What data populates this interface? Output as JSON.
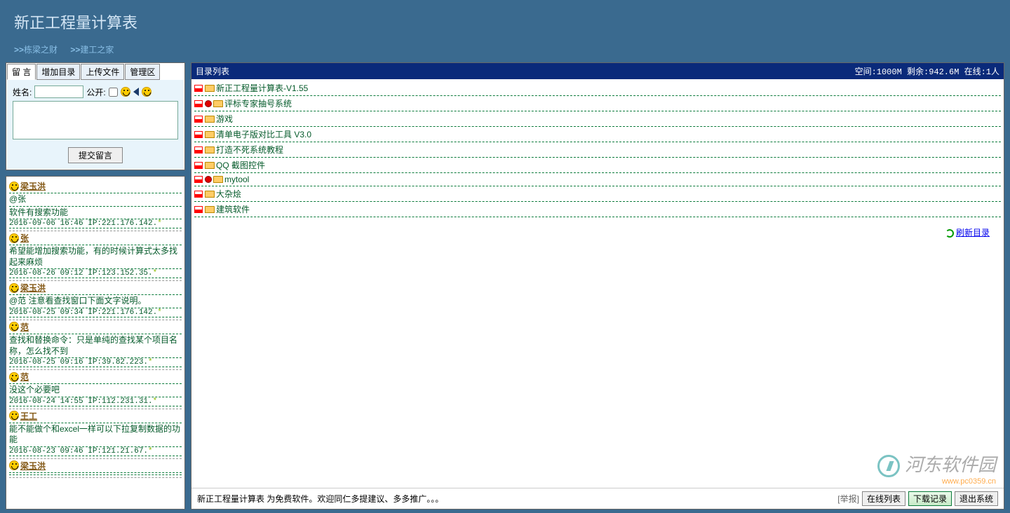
{
  "header": {
    "title": "新正工程量计算表",
    "links": [
      "栋梁之财",
      "建工之家"
    ]
  },
  "tabs": [
    "留 言",
    "增加目录",
    "上传文件",
    "管理区"
  ],
  "form": {
    "name_label": "姓名:",
    "public_label": "公开:",
    "submit": "提交留言"
  },
  "messages": [
    {
      "name": "梁玉洪",
      "body": "@张\n软件有搜索功能",
      "meta": "2016-09-06 16:46 IP:221.176.142.*"
    },
    {
      "name": "张",
      "body": "希望能增加搜索功能，有的时候计算式太多找起来麻烦",
      "meta": "2016-08-26 09:12 IP:123.152.35.*"
    },
    {
      "name": "梁玉洪",
      "body": "@范 注意看查找窗口下面文字说明。",
      "meta": "2016-08-25 09:34 IP:221.176.142.*"
    },
    {
      "name": "范",
      "body": "查找和替换命令：只是单纯的查找某个项目名称，怎么找不到",
      "meta": "2016-08-25 09:16 IP:39.82.223.*"
    },
    {
      "name": "范",
      "body": "没这个必要吧",
      "meta": "2016-08-24 14:55 IP:112.231.31.*"
    },
    {
      "name": "王工",
      "body": "能不能做个和excel一样可以下拉复制数据的功能",
      "meta": "2016-08-23 09:46 IP:121.21.67.*"
    },
    {
      "name": "梁玉洪",
      "body": "",
      "meta": ""
    }
  ],
  "dir_header": {
    "title": "目录列表",
    "stats": "空间:1000M 剩余:942.6M 在线:1人"
  },
  "dirs": [
    {
      "locked": false,
      "name": "新正工程量计算表-V1.55"
    },
    {
      "locked": true,
      "name": "评标专家抽号系统"
    },
    {
      "locked": false,
      "name": "游戏"
    },
    {
      "locked": false,
      "name": "清单电子版对比工具 V3.0"
    },
    {
      "locked": false,
      "name": "打造不死系统教程"
    },
    {
      "locked": false,
      "name": "QQ 截图控件"
    },
    {
      "locked": true,
      "name": "mytool"
    },
    {
      "locked": false,
      "name": "大杂烩"
    },
    {
      "locked": false,
      "name": "建筑软件"
    }
  ],
  "refresh": "刷新目录",
  "footer": {
    "text": "新正工程量计算表 为免费软件。欢迎同仁多提建议、多多推广。。。",
    "report": "[举报]",
    "btns": [
      "在线列表",
      "下载记录",
      "退出系统"
    ]
  },
  "watermark": {
    "text": "河东软件园",
    "sub": "www.pc0359.cn"
  }
}
